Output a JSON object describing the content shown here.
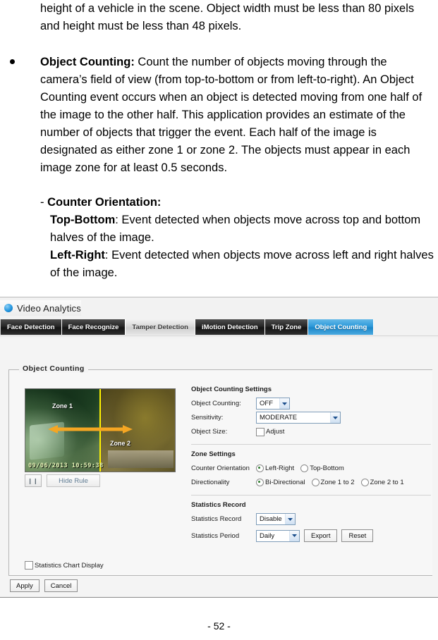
{
  "document": {
    "para_continuation": "height of a vehicle in the scene. Object width must be less than 80 pixels and height must be less than 48 pixels.",
    "bullet": {
      "term": "Object Counting:",
      "body": " Count the number of objects moving through the camera’s field of view (from top-to-bottom or from left-to-right). An Object Counting event occurs when an object is detected moving from one half of the image to the other half. This application provides an estimate of the number of objects that trigger the event. Each half of the image is designated as either zone 1 or zone 2. The objects must appear in each image zone for at least 0.5 seconds."
    },
    "sub": {
      "dash": "-",
      "heading": "Counter Orientation:",
      "item1_term": "Top-Bottom",
      "item1_body": ": Event detected when objects move across top and bottom halves of the image.",
      "item2_term": "Left-Right",
      "item2_body": ": Event detected when objects move across left and right halves of the image."
    },
    "page_number": "- 52 -"
  },
  "screenshot": {
    "header": {
      "title": "Video Analytics",
      "bullet_icon": "blue-circle-icon"
    },
    "tabs": [
      {
        "label": "Face Detection",
        "state": "normal"
      },
      {
        "label": "Face Recognize",
        "state": "normal"
      },
      {
        "label": "Tamper Detection",
        "state": "hover"
      },
      {
        "label": "iMotion Detection",
        "state": "normal"
      },
      {
        "label": "Trip Zone",
        "state": "normal"
      },
      {
        "label": "Object Counting",
        "state": "active"
      }
    ],
    "fieldset_legend": "Object Counting",
    "video": {
      "zone1_label": "Zone 1",
      "zone2_label": "Zone 2",
      "timestamp": "09/06/2013  10:59:38",
      "divider_color": "#fff200",
      "arrow_color": "#f5a623",
      "pause_button": "❙❙",
      "hide_rule_button": "Hide Rule"
    },
    "object_counting_settings": {
      "section_title": "Object Counting Settings",
      "object_counting": {
        "label": "Object Counting:",
        "value": "OFF"
      },
      "sensitivity": {
        "label": "Sensitivity:",
        "value": "MODERATE"
      },
      "object_size": {
        "label": "Object Size:",
        "checkbox_label": "Adjust",
        "checked": false
      }
    },
    "zone_settings": {
      "section_title": "Zone Settings",
      "counter_orientation": {
        "label": "Counter Orientation",
        "options": [
          {
            "label": "Left-Right",
            "selected": true
          },
          {
            "label": "Top-Bottom",
            "selected": false
          }
        ]
      },
      "directionality": {
        "label": "Directionality",
        "options": [
          {
            "label": "Bi-Directional",
            "selected": true
          },
          {
            "label": "Zone 1 to 2",
            "selected": false
          },
          {
            "label": "Zone 2 to 1",
            "selected": false
          }
        ]
      }
    },
    "statistics_record": {
      "section_title": "Statistics Record",
      "record": {
        "label": "Statistics Record",
        "value": "Disable"
      },
      "period": {
        "label": "Statistics Period",
        "value": "Daily"
      },
      "export_button": "Export",
      "reset_button": "Reset"
    },
    "statistics_chart_display": {
      "label": "Statistics Chart Display",
      "checked": false
    },
    "form_actions": {
      "apply": "Apply",
      "cancel": "Cancel"
    },
    "colors": {
      "active_tab": "#2e9ada",
      "tab_dark": "#262626",
      "zone_divider": "#fff200",
      "arrow": "#f5a623",
      "radio_dot": "#2c7a2c"
    }
  }
}
